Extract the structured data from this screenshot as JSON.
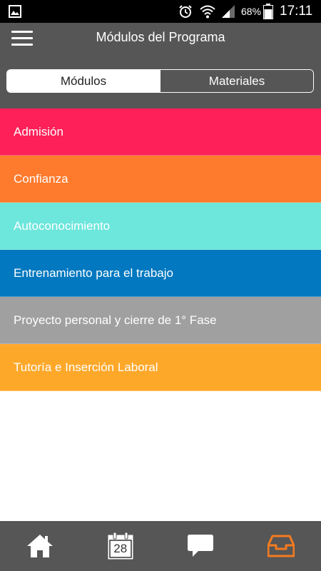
{
  "status_bar": {
    "battery_percent": "68%",
    "time": "17:11",
    "icons": [
      "gallery-icon",
      "alarm-icon",
      "wifi-icon",
      "signal-icon",
      "battery-icon"
    ]
  },
  "header": {
    "title": "Módulos del Programa",
    "menu_icon": "hamburger-menu-icon",
    "background_color": "#565656"
  },
  "segmented_control": {
    "options": [
      "Módulos",
      "Materiales"
    ],
    "selected": "Módulos"
  },
  "modules": [
    {
      "label": "Admisión",
      "color": "#fe2058"
    },
    {
      "label": "Confianza",
      "color": "#fe7a2c"
    },
    {
      "label": "Autoconocimiento",
      "color": "#6de6dc"
    },
    {
      "label": "Entrenamiento para el trabajo",
      "color": "#0178bf"
    },
    {
      "label": "Proyecto personal y cierre de 1° Fase",
      "color": "#a0a0a0"
    },
    {
      "label": "Tutoría e Inserción Laboral",
      "color": "#fea82a"
    }
  ],
  "tab_bar": {
    "tabs": [
      {
        "icon": "home-icon",
        "active": false
      },
      {
        "icon": "calendar-icon",
        "calendar_day": "28",
        "active": false
      },
      {
        "icon": "chat-bubble-icon",
        "active": false
      },
      {
        "icon": "inbox-tray-icon",
        "active": true
      }
    ],
    "active_color": "#f47b20",
    "inactive_color": "#ffffff"
  }
}
